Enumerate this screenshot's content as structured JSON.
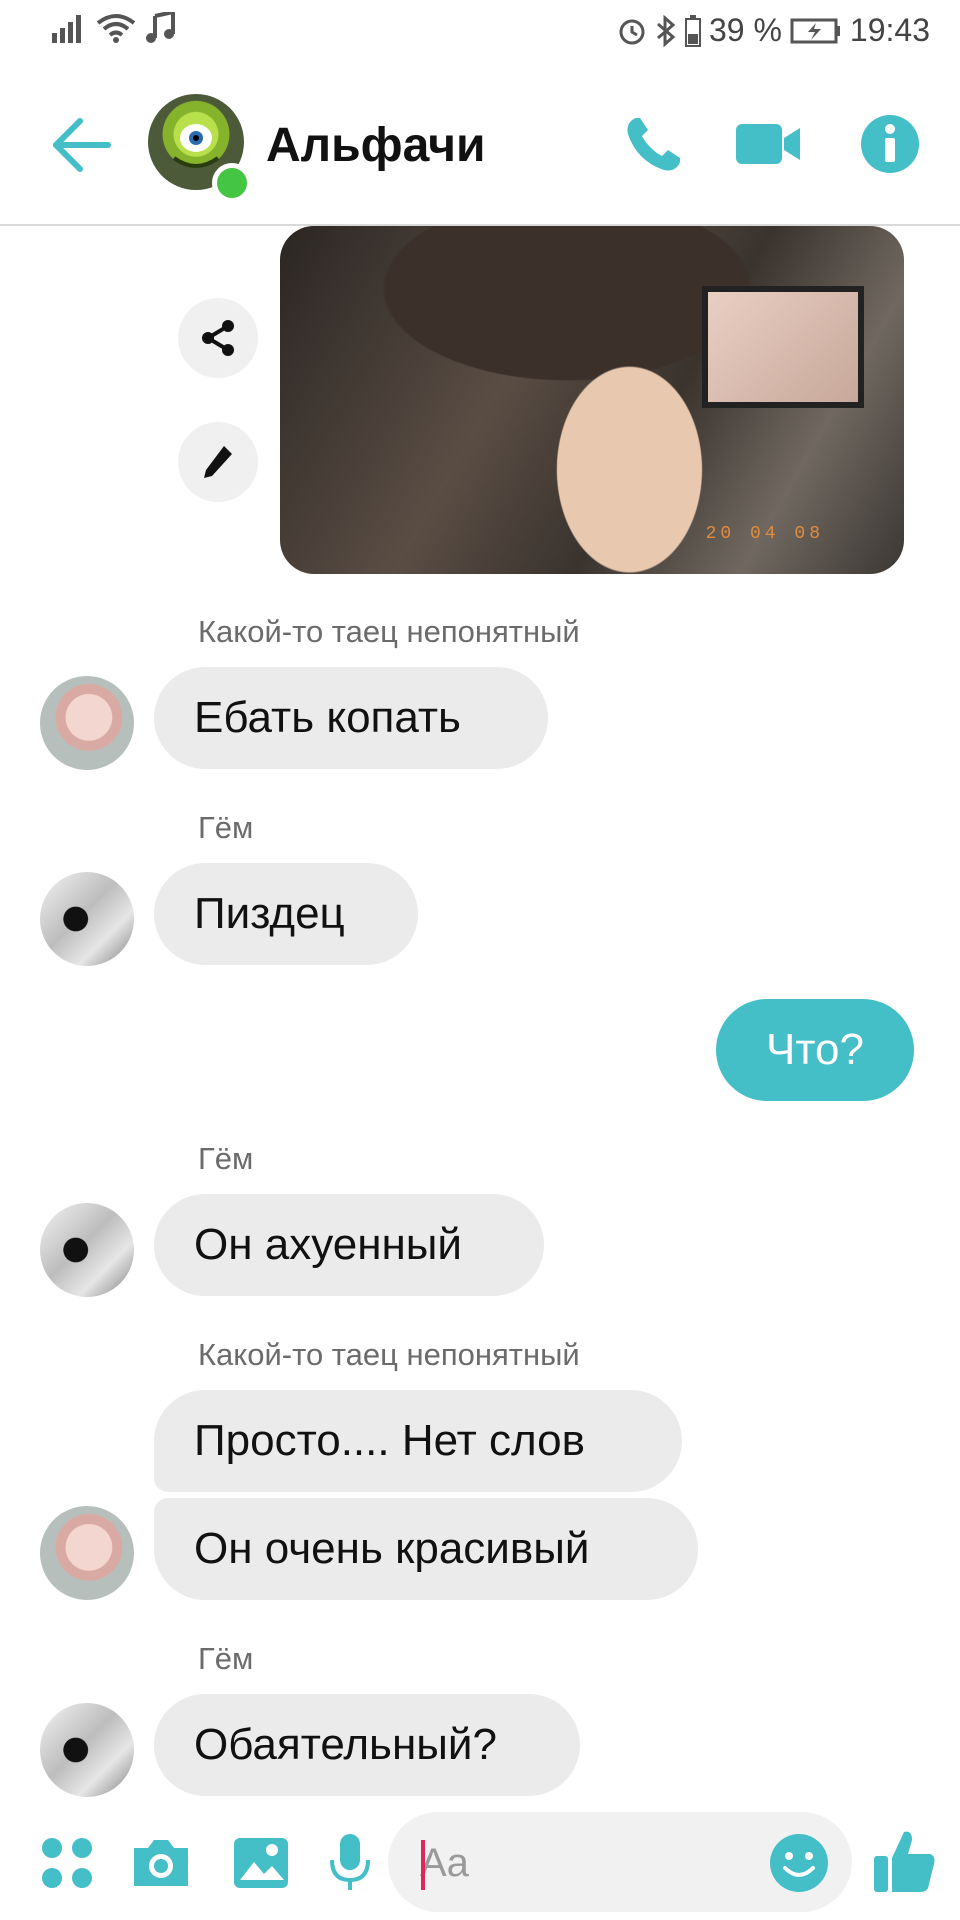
{
  "status_bar": {
    "battery": "39 %",
    "time": "19:43",
    "icons": [
      "signal-icon",
      "wifi-icon",
      "music-note-icon",
      "alarm-icon",
      "bluetooth-icon",
      "battery-icon",
      "charging-icon"
    ]
  },
  "header": {
    "title": "Альфачи",
    "accent_color": "#44bec7",
    "online_color": "#44c544"
  },
  "photo_message": {
    "stamp": "20 04 08"
  },
  "messages": [
    {
      "sender": "Какой-то таец непонятный",
      "texts": [
        "Ебать копать"
      ]
    },
    {
      "sender": "Гём",
      "texts": [
        "Пиздец"
      ]
    },
    {
      "mine": true,
      "texts": [
        "Что?"
      ]
    },
    {
      "sender": "Гём",
      "texts": [
        "Он ахуенный"
      ]
    },
    {
      "sender": "Какой-то таец непонятный",
      "texts": [
        "Просто.... Нет слов",
        "Он очень красивый"
      ]
    },
    {
      "sender": "Гём",
      "texts": [
        "Обаятельный?"
      ]
    }
  ],
  "composer": {
    "placeholder": "Aa",
    "bubble_color": "#ebebeb"
  }
}
